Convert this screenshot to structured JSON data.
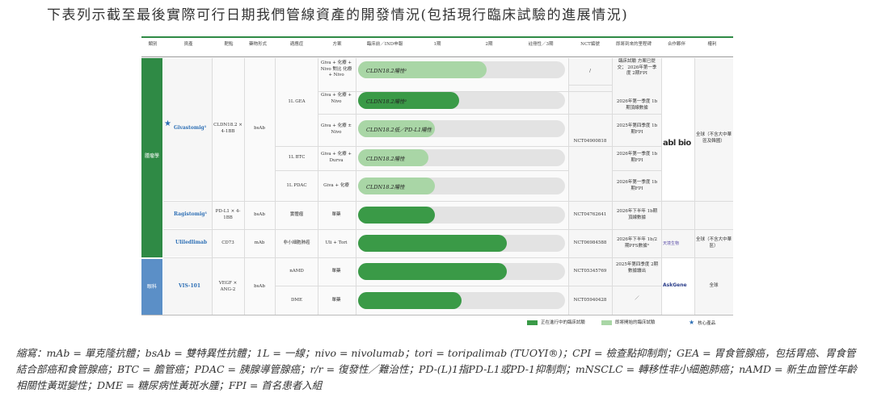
{
  "heading": "下表列示截至最後實際可行日期我們管線資產的開發情況(包括現行臨床試驗的進展情況)",
  "headers": {
    "segment": "類別",
    "asset": "資產",
    "target": "靶點",
    "modality": "藥物形式",
    "indication": "適應症",
    "regimen": "方案",
    "preclinical": "臨床前／IND申報",
    "phase1": "1期",
    "phase2": "2期",
    "phase3": "註冊性／3期",
    "nct": "NCT編號",
    "milestone": "即將到來的里程碑",
    "partner": "合作夥伴",
    "rights": "權利"
  },
  "segments": {
    "oncology": "腫瘤學",
    "ophthalmology": "眼科"
  },
  "assets": {
    "givastomig": "Givastomig¹",
    "ragistomig": "Ragistomig¹",
    "uliledlimab": "Uliledlimab",
    "vis101": "VIS-101"
  },
  "targets": {
    "givastomig": "CLDN18.2 × 4-1BB",
    "ragistomig": "PD-L1 × 4-1BB",
    "uliledlimab": "CD73",
    "vis101": "VEGF × ANG-2"
  },
  "modalities": {
    "bsab": "bsAb",
    "mab": "mAb"
  },
  "indications": {
    "gea": "1L GEA",
    "btc": "1L BTC",
    "pdac": "1L PDAC",
    "solid": "實體瘤",
    "nsclc": "非小細胞肺癌",
    "namd": "nAMD",
    "dme": "DME"
  },
  "regimens": {
    "r1": "Giva + 化療 + Nivo 對比 化療 + Nivo",
    "r2": "Giva + 化療 + Nivo",
    "r3": "Giva + 化療 ± Nivo",
    "r4": "Giva + 化療 + Durva",
    "r5": "Giva + 化療",
    "r6": "單藥",
    "r7": "Uli + Tori",
    "r8": "單藥",
    "r9": "單藥"
  },
  "bars": [
    {
      "label": "CLDN18.2陽性²",
      "progress": 0.62,
      "stage": "planned"
    },
    {
      "label": "CLDN18.2陽性²",
      "progress": 0.49,
      "stage": "ongoing"
    },
    {
      "label": "CLDN18.2低／PD-L1陽性",
      "progress": 0.37,
      "stage": "planned"
    },
    {
      "label": "CLDN18.2陽性",
      "progress": 0.34,
      "stage": "planned"
    },
    {
      "label": "CLDN18.2陽性",
      "progress": 0.37,
      "stage": "planned"
    },
    {
      "label": "",
      "progress": 0.37,
      "stage": "ongoing"
    },
    {
      "label": "",
      "progress": 0.72,
      "stage": "ongoing"
    },
    {
      "label": "",
      "progress": 0.72,
      "stage": "ongoing"
    },
    {
      "label": "",
      "progress": 0.5,
      "stage": "ongoing"
    }
  ],
  "nct": {
    "r1": "/",
    "giva": "NCT04900818",
    "ragi": "NCT04762641",
    "uli": "NCT06984588",
    "namd": "NCT05345769",
    "dme": "NCT05940428"
  },
  "milestones": {
    "m1": "臨床試驗 方案已提交； 2026年第一季度 2期FPI",
    "m2": "2026年第一季度 1b期頂線數據",
    "m3": "2025年第四季度 1b期FPI",
    "m4": "2026年第一季度 1b期FPI",
    "m5": "2026年第一季度 1b期FPI",
    "m6": "2026年下半年 1b期頂線數據",
    "m7": "2026年下半年 1b/2期PFS數據³",
    "m8": "2025年第四季度 2期 數據讀出",
    "m9": "／"
  },
  "partners": {
    "abl": "abl bio",
    "cn": "天境生物",
    "askgene": "AskGene"
  },
  "rights": {
    "giva": "全球（不含大中華區及韓國）",
    "uli": "全球（不含大中華區）",
    "vis": "全球"
  },
  "legend": {
    "ongoing": "正在進行中的臨床試驗",
    "planned": "即將開始的臨床試驗",
    "core": "核心產品"
  },
  "abbreviations": "縮寫：mAb = 單克隆抗體；bsAb = 雙特異性抗體；1L = 一線；nivo = nivolumab；tori = toripalimab (TUOYI®)；CPI = 檢查點抑制劑；GEA = 胃食管腺癌，包括胃癌、胃食管結合部癌和食管腺癌；BTC = 膽管癌；PDAC = 胰腺導管腺癌；r/r = 復發性／難治性；PD-(L)1指PD-L1或PD-1抑制劑；mNSCLC = 轉移性非小細胞肺癌；nAMD = 新生血管性年齡相關性黃斑變性；DME = 糖尿病性黃斑水腫；FPI = 首名患者入組",
  "colors": {
    "ongoing": "#3a9a47",
    "planned": "#a9d6a6",
    "track": "#e3e3e3",
    "oncology": "#2f8a45",
    "ophthalmology": "#5b8fc7",
    "asset_text": "#2d6fb5"
  }
}
